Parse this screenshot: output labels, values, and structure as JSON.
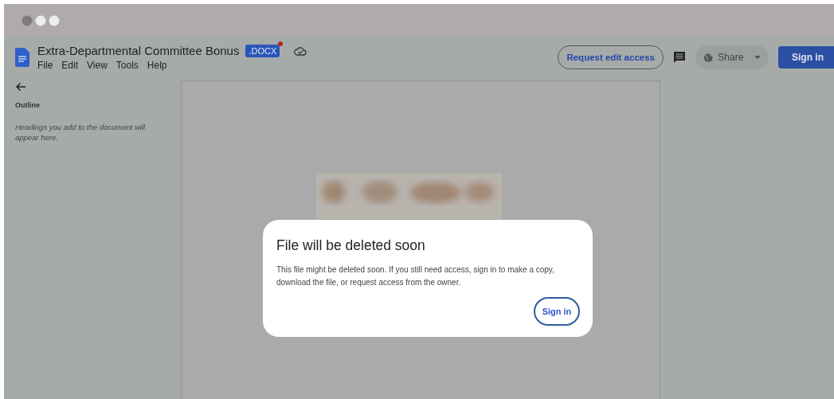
{
  "document": {
    "title": "Extra-Departmental Committee Bonus",
    "badge": ".DOCX",
    "badge_dot": true
  },
  "menu": [
    "File",
    "Edit",
    "View",
    "Tools",
    "Help"
  ],
  "toolbar": {
    "request_button": "Request edit access",
    "share_button": "Share",
    "sign_in_button": "Sign in"
  },
  "outline": {
    "title": "Outline",
    "hint": "Headings you add to the document will appear here."
  },
  "dialog": {
    "title": "File will be deleted soon",
    "message": "This file might be deleted soon. If you still need access, sign in to make a copy, download the file, or request access from the owner.",
    "button": "Sign in"
  }
}
